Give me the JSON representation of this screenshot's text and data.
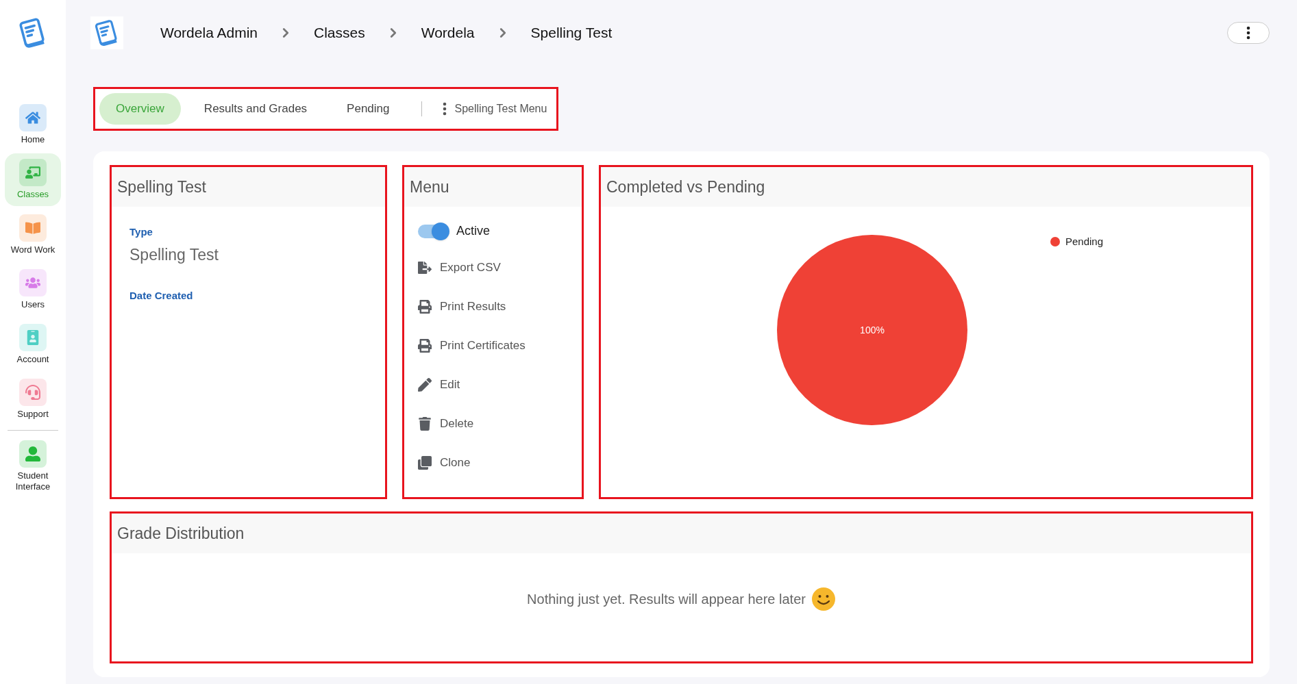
{
  "sidebar": {
    "items": [
      {
        "label": "Home",
        "selected": false,
        "color": "#3b8de0"
      },
      {
        "label": "Classes",
        "selected": true,
        "color": "#2fb344"
      },
      {
        "label": "Word Work",
        "selected": false,
        "color": "#f5934a"
      },
      {
        "label": "Users",
        "selected": false,
        "color": "#d77be8"
      },
      {
        "label": "Account",
        "selected": false,
        "color": "#4fcfc4"
      },
      {
        "label": "Support",
        "selected": false,
        "color": "#ef7a92"
      },
      {
        "label": "Student Interface",
        "selected": false,
        "color": "#22b83a"
      }
    ]
  },
  "breadcrumbs": [
    "Wordela Admin",
    "Classes",
    "Wordela",
    "Spelling Test"
  ],
  "tabs": [
    {
      "label": "Overview",
      "selected": true
    },
    {
      "label": "Results and Grades",
      "selected": false
    },
    {
      "label": "Pending",
      "selected": false
    }
  ],
  "tab_menu": {
    "label": "Spelling Test Menu"
  },
  "details": {
    "title": "Spelling Test",
    "fields": [
      {
        "label": "Type",
        "value": "Spelling Test"
      },
      {
        "label": "Date Created"
      }
    ]
  },
  "menu": {
    "title": "Menu",
    "items": [
      {
        "kind": "toggle",
        "label": "Active",
        "on": true
      },
      {
        "kind": "action",
        "label": "Export CSV"
      },
      {
        "kind": "action",
        "label": "Print Results"
      },
      {
        "kind": "action",
        "label": "Print Certificates"
      },
      {
        "kind": "action",
        "label": "Edit"
      },
      {
        "kind": "action",
        "label": "Delete"
      },
      {
        "kind": "action",
        "label": "Clone"
      }
    ]
  },
  "completion": {
    "title": "Completed vs Pending",
    "pie": {
      "slices": [
        {
          "name": "Pending",
          "label": "100%",
          "color": "#ef4136"
        }
      ]
    }
  },
  "grades": {
    "title": "Grade Distribution",
    "message": "Nothing just yet. Results will appear here later"
  }
}
